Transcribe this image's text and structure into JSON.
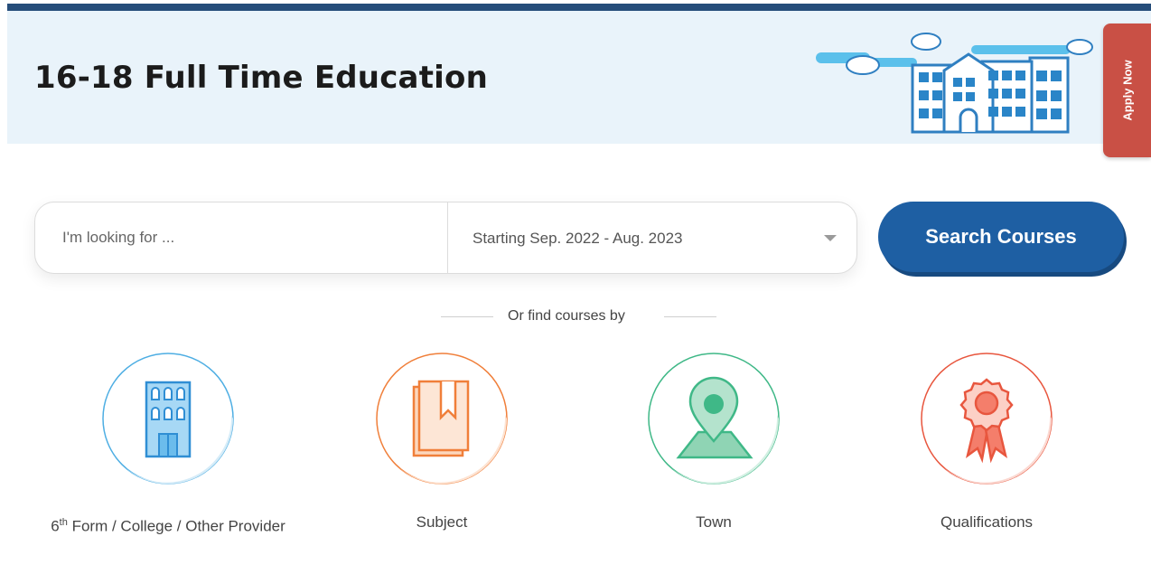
{
  "header": {
    "title": "16-18 Full Time Education"
  },
  "apply_tab": {
    "label": "Apply Now"
  },
  "search": {
    "placeholder": "I'm looking for ...",
    "value": "",
    "date_range": "Starting Sep. 2022 - Aug. 2023",
    "button_label": "Search Courses"
  },
  "find_by": {
    "label": "Or find courses by"
  },
  "categories": [
    {
      "label_prefix": "6",
      "label_sup": "th",
      "label_rest": " Form / College / Other Provider",
      "icon": "building-icon",
      "color": "#4eaee3"
    },
    {
      "label": "Subject",
      "icon": "book-icon",
      "color": "#f07f3a"
    },
    {
      "label": "Town",
      "icon": "map-pin-icon",
      "color": "#3fb887"
    },
    {
      "label": "Qualifications",
      "icon": "award-ribbon-icon",
      "color": "#e8563e"
    }
  ],
  "colors": {
    "brand_blue": "#1e5fa3",
    "topbar": "#264d7a",
    "header_bg": "#e9f3fa",
    "apply_red": "#c95045"
  }
}
